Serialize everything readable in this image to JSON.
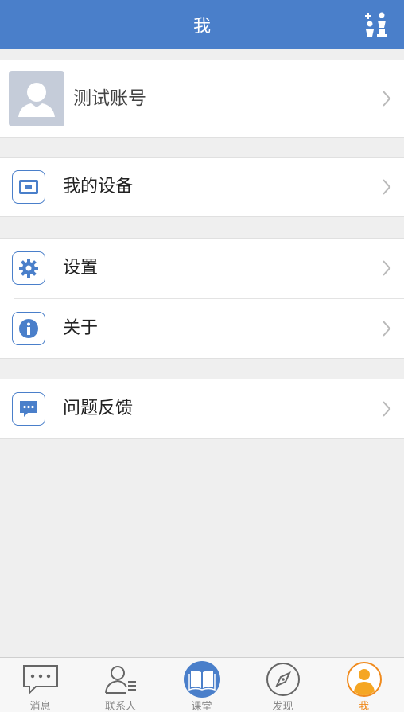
{
  "header": {
    "title": "我",
    "action_icon": "add-contact-icon"
  },
  "profile": {
    "name": "测试账号",
    "avatar_icon": "default-avatar-icon"
  },
  "menu": {
    "device": {
      "label": "我的设备",
      "icon": "device-icon"
    },
    "settings": {
      "label": "设置",
      "icon": "gear-icon"
    },
    "about": {
      "label": "关于",
      "icon": "info-icon"
    },
    "feedback": {
      "label": "问题反馈",
      "icon": "feedback-icon"
    }
  },
  "tabbar": {
    "items": [
      {
        "label": "消息",
        "icon": "message-icon"
      },
      {
        "label": "联系人",
        "icon": "contacts-icon"
      },
      {
        "label": "课堂",
        "icon": "book-icon"
      },
      {
        "label": "发现",
        "icon": "compass-icon"
      },
      {
        "label": "我",
        "icon": "profile-icon",
        "active": true
      }
    ]
  },
  "colors": {
    "primary": "#4a7fca",
    "active_tab": "#f08a1c",
    "background": "#efefef"
  }
}
